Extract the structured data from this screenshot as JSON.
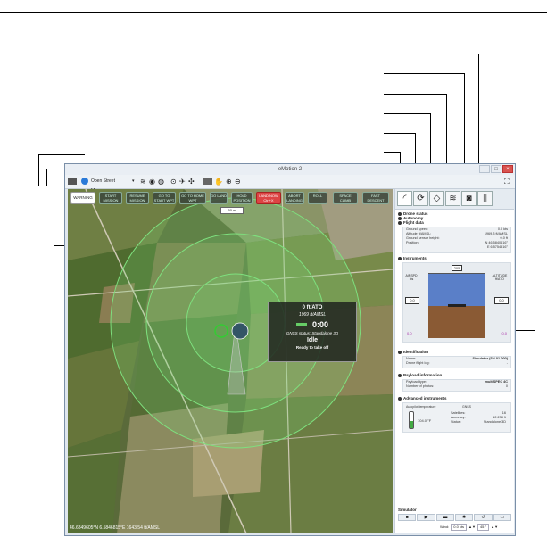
{
  "window": {
    "title": "eMotion 2"
  },
  "toolbar": {
    "map_source": "Open Street Maps"
  },
  "map": {
    "scale": "50 m",
    "buttons": [
      {
        "label": "WARNING"
      },
      {
        "label": "START MISSION"
      },
      {
        "label": "RESUME MISSION"
      },
      {
        "label": "GO TO START WPT"
      },
      {
        "label": "GO TO HOME WPT"
      },
      {
        "label": "GO LAND"
      },
      {
        "label": "HOLD POSITION"
      },
      {
        "label": "LAND NOW Ctrl+X"
      },
      {
        "label": "ABORT LANDING"
      },
      {
        "label": "ROLL"
      },
      {
        "label": "SPACE CLIMB"
      },
      {
        "label": "FAST DESCENT"
      }
    ],
    "info": {
      "altitude": "0 ft/ATO",
      "altitude_msl": "1969 ft/AMSL",
      "timer": "0:00",
      "gnss": "GNSS status: Standalone 3D",
      "state": "Idle",
      "ready": "Ready to take off"
    },
    "coords": "46.6849605°N  6.5846815°E  1643.54 ft/AMSL"
  },
  "panel": {
    "sections": {
      "drone_status": "Drone status",
      "autonomy": "Autonomy",
      "flight_data": "Flight data",
      "instruments": "Instruments",
      "identification": "Identification",
      "payload_info": "Payload information",
      "advanced": "Advanced instruments",
      "simulator": "Simulator"
    },
    "flight_data": [
      {
        "label": "Ground speed:",
        "value": "0.0 kts"
      },
      {
        "label": "Altitude ft/AMSL:",
        "value": "1969.3 ft/AMSL"
      },
      {
        "label": "Ground sensor height:",
        "value": "0.0 ft"
      },
      {
        "label": "Position:",
        "value": "N 46.5840616°"
      },
      {
        "label": "",
        "value": "E 6.5754516°"
      }
    ],
    "instruments": {
      "airspeed_label": "AIRSPD kts",
      "altitude_label": "ALTITUDE ft/ATO",
      "heading": "205",
      "left_value": "0.0",
      "right_value": "0.0",
      "left_bottom": "0.0",
      "right_bottom": "0.0"
    },
    "identification": [
      {
        "label": "Name:",
        "value": "Simulator (SN-01-000)"
      },
      {
        "label": "Drone flight log:",
        "value": "-"
      }
    ],
    "payload": [
      {
        "label": "Payload type:",
        "value": "multiSPEC 4C"
      },
      {
        "label": "Number of photos:",
        "value": "0"
      }
    ],
    "advanced": {
      "autopilot_temp_label": "Autopilot temperature",
      "temp": "104.0 °F",
      "gnss_title": "GNSS",
      "rows": [
        {
          "label": "Satellites:",
          "value": "16"
        },
        {
          "label": "Accuracy:",
          "value": "12.238 ft"
        },
        {
          "label": "Status:",
          "value": "Standalone 3D"
        }
      ]
    },
    "simulator": {
      "wind_label": "Wind:",
      "wind_speed": "0.0 kts",
      "wind_dir": "45 °"
    }
  }
}
